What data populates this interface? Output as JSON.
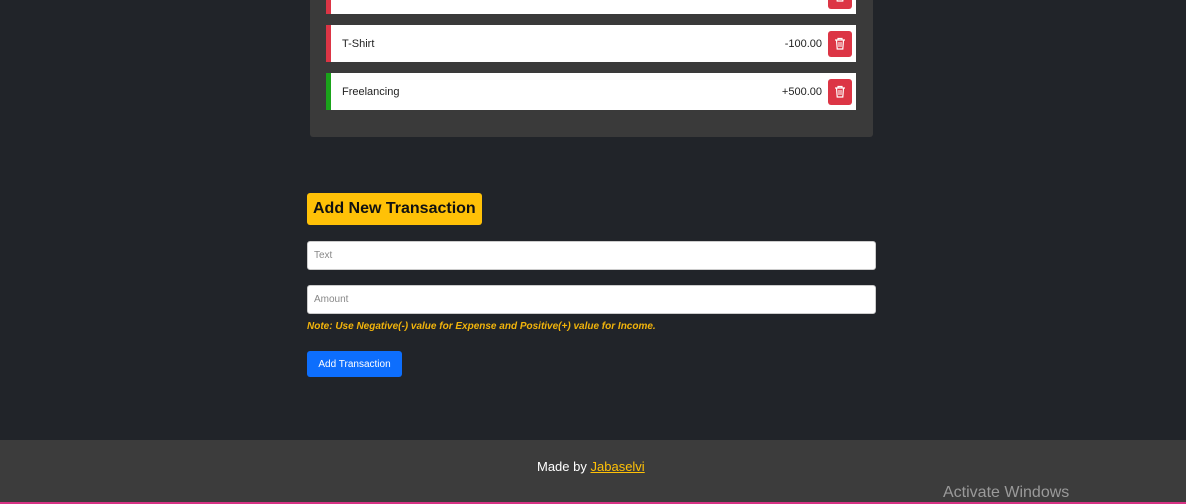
{
  "transactions": [
    {
      "name": "",
      "amount": "",
      "type": "expense"
    },
    {
      "name": "T-Shirt",
      "amount": "-100.00",
      "type": "expense"
    },
    {
      "name": "Freelancing",
      "amount": "+500.00",
      "type": "income"
    }
  ],
  "form": {
    "heading": "Add New Transaction",
    "text_placeholder": "Text",
    "amount_placeholder": "Amount",
    "note": "Note: Use Negative(-) value for Expense and Positive(+) value for Income.",
    "button_label": "Add Transaction"
  },
  "footer": {
    "prefix": "Made by",
    "author": "Jabaselvi"
  },
  "watermark": "Activate Windows",
  "icons": {
    "delete": "trash-icon"
  },
  "colors": {
    "expense": "#dc3545",
    "income": "#1aa31a",
    "accent": "#ffc107",
    "primary": "#0d6efd"
  }
}
